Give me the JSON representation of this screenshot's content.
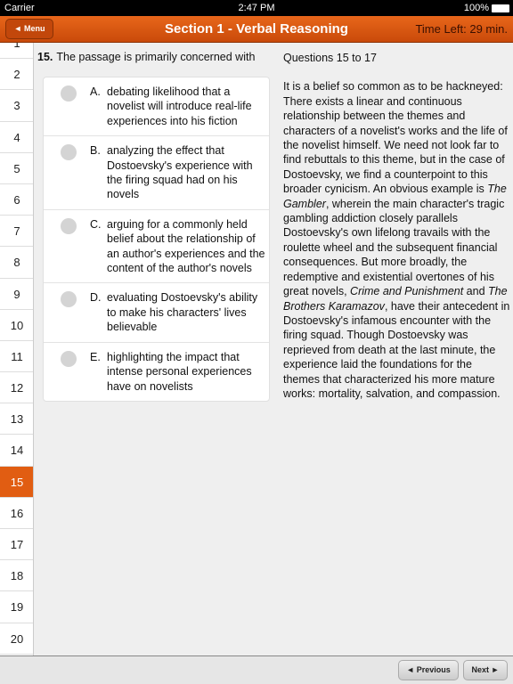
{
  "status_bar": {
    "carrier": "Carrier",
    "time": "2:47 PM",
    "battery": "100%"
  },
  "header": {
    "menu_label": "◄ Menu",
    "title": "Section 1 - Verbal Reasoning",
    "time_left": "Time Left: 29 min."
  },
  "sidebar": {
    "items": [
      "1",
      "2",
      "3",
      "4",
      "5",
      "6",
      "7",
      "8",
      "9",
      "10",
      "11",
      "12",
      "13",
      "14",
      "15",
      "16",
      "17",
      "18",
      "19",
      "20"
    ],
    "active": "15"
  },
  "question": {
    "number": "15.",
    "text": "The passage is primarily concerned with",
    "options": [
      {
        "letter": "A.",
        "text": "debating likelihood that a novelist will introduce real-life experiences into his fiction"
      },
      {
        "letter": "B.",
        "text": "analyzing the effect that Dostoevsky's experience with the firing squad had on his novels"
      },
      {
        "letter": "C.",
        "text": "arguing for a commonly held belief about the relationship of an author's experiences and the content of the author's novels"
      },
      {
        "letter": "D.",
        "text": "evaluating Dostoevsky's ability to make his characters' lives believable"
      },
      {
        "letter": "E.",
        "text": "highlighting the impact that intense personal experiences have on novelists"
      }
    ]
  },
  "passage": {
    "heading": "Questions 15 to 17",
    "p1": "It is a belief so common as to be hackneyed: There exists a linear and continuous relationship between the themes and characters of a novelist's works and the life of the novelist himself. We need not look far to find rebuttals to this theme, but in the case of Dostoevsky, we find a counterpoint to this broader cynicism. An obvious example is ",
    "i1": "The Gambler",
    "p2": ", wherein the main character's tragic gambling addiction closely parallels Dostoevsky's own lifelong travails with the roulette wheel and the subsequent financial consequences. But more broadly, the redemptive and existential overtones of his great novels, ",
    "i2": "Crime and Punishment",
    "p3": " and ",
    "i3": "The Brothers Karamazov",
    "p4": ", have their antecedent in Dostoevsky's infamous encounter with the firing squad. Though Dostoevsky was reprieved from death at the last minute, the experience laid the foundations for the themes that characterized his more mature works: mortality, salvation, and compassion."
  },
  "footer": {
    "previous_label": "◄ Previous",
    "next_label": "Next ►"
  }
}
